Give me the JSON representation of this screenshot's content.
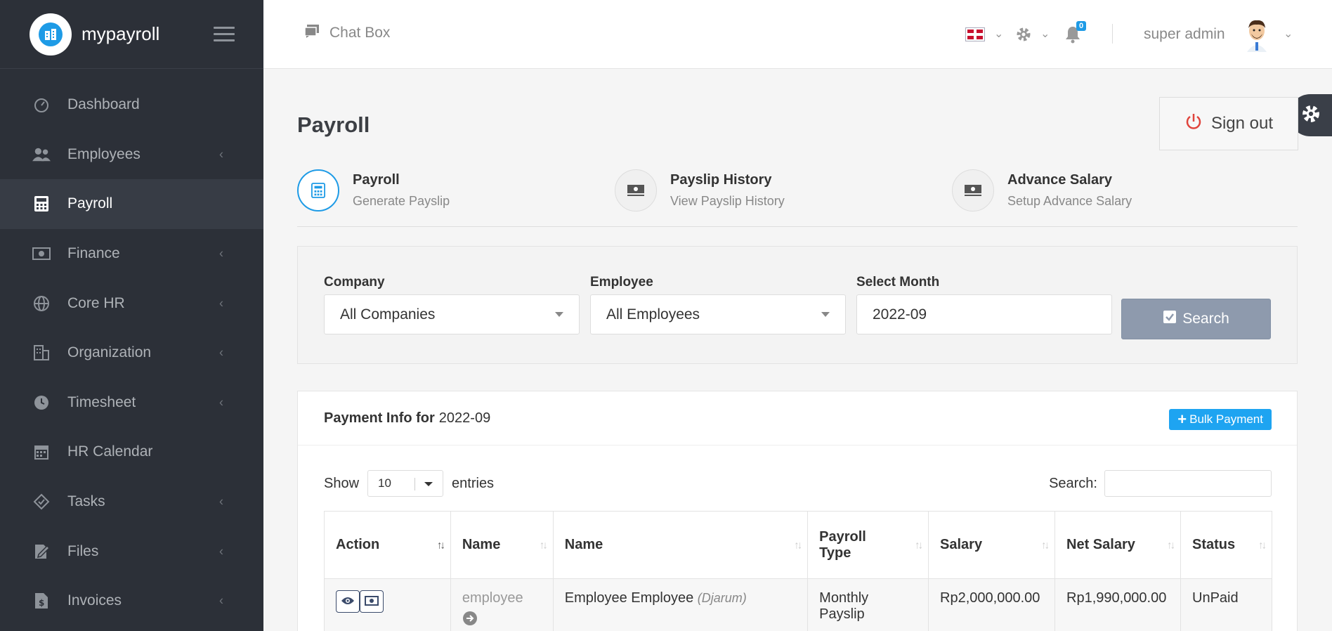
{
  "brand": {
    "name": "mypayroll"
  },
  "sidebar": {
    "items": [
      {
        "label": "Dashboard",
        "icon": "dashboard-icon",
        "has_submenu": false
      },
      {
        "label": "Employees",
        "icon": "users-icon",
        "has_submenu": true
      },
      {
        "label": "Payroll",
        "icon": "calculator-icon",
        "has_submenu": false,
        "active": true
      },
      {
        "label": "Finance",
        "icon": "money-icon",
        "has_submenu": true
      },
      {
        "label": "Core HR",
        "icon": "globe-icon",
        "has_submenu": true
      },
      {
        "label": "Organization",
        "icon": "building-icon",
        "has_submenu": true
      },
      {
        "label": "Timesheet",
        "icon": "clock-icon",
        "has_submenu": true
      },
      {
        "label": "HR Calendar",
        "icon": "calendar-icon",
        "has_submenu": false
      },
      {
        "label": "Tasks",
        "icon": "tasks-icon",
        "has_submenu": true
      },
      {
        "label": "Files",
        "icon": "file-icon",
        "has_submenu": true
      },
      {
        "label": "Invoices",
        "icon": "invoice-icon",
        "has_submenu": true
      }
    ]
  },
  "topbar": {
    "chatbox_label": "Chat Box",
    "notification_count": "0",
    "username": "super admin"
  },
  "page": {
    "title": "Payroll",
    "signout_label": "Sign out"
  },
  "steps": [
    {
      "title": "Payroll",
      "subtitle": "Generate Payslip",
      "icon": "calculator-icon"
    },
    {
      "title": "Payslip History",
      "subtitle": "View Payslip History",
      "icon": "money-icon"
    },
    {
      "title": "Advance Salary",
      "subtitle": "Setup Advance Salary",
      "icon": "money-icon"
    }
  ],
  "filters": {
    "company_label": "Company",
    "company_value": "All Companies",
    "employee_label": "Employee",
    "employee_value": "All Employees",
    "month_label": "Select Month",
    "month_value": "2022-09",
    "search_label": "Search"
  },
  "payment": {
    "heading_bold": "Payment Info for",
    "heading_month": "2022-09",
    "bulk_label": "Bulk Payment",
    "show_label": "Show",
    "entries_value": "10",
    "entries_label": "entries",
    "search_label": "Search:",
    "columns": [
      "Action",
      "Name",
      "Name",
      "Payroll Type",
      "Salary",
      "Net Salary",
      "Status"
    ],
    "rows": [
      {
        "username": "employee",
        "fullname": "Employee Employee",
        "company": "(Djarum)",
        "payroll_type": "Monthly Payslip",
        "salary": "Rp2,000,000.00",
        "net_salary": "Rp1,990,000.00",
        "status": "UnPaid"
      }
    ]
  },
  "colors": {
    "sidebar_bg": "#2c3038",
    "accent": "#1e9be6",
    "search_btn": "#8e9aad",
    "signout_icon": "#e0443c"
  }
}
